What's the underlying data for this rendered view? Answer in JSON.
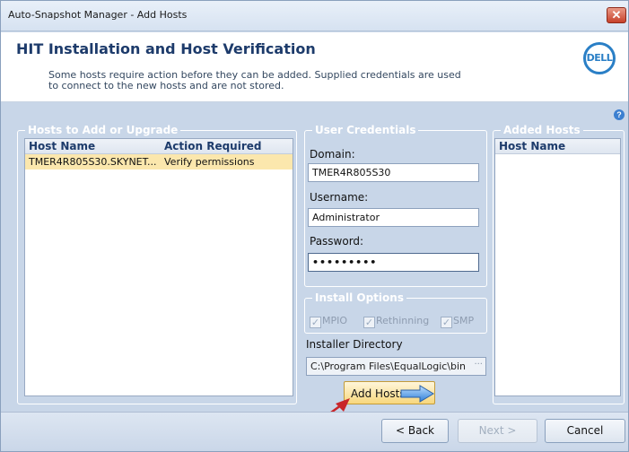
{
  "window": {
    "title": "Auto-Snapshot Manager - Add Hosts",
    "close_glyph": "✕"
  },
  "header": {
    "title": "HIT Installation and Host Verification",
    "description": "Some hosts require action before they can be added.  Supplied credentials are used to connect to the new hosts and are not stored.",
    "logo_text": "DELL"
  },
  "hosts_to_add": {
    "legend": "Hosts to Add or Upgrade",
    "columns": [
      "Host Name",
      "Action Required"
    ],
    "rows": [
      {
        "host": "TMER4R805S30.SKYNET...",
        "action": "Verify permissions"
      }
    ]
  },
  "credentials": {
    "legend": "User Credentials",
    "domain_label": "Domain:",
    "domain_value": "TMER4R805S30",
    "username_label": "Username:",
    "username_value": "Administrator",
    "password_label": "Password:",
    "password_value": "•••••••••"
  },
  "install_options": {
    "legend": "Install Options",
    "options": [
      "MPIO",
      "Rethinning",
      "SMP"
    ],
    "installer_dir_label": "Installer Directory",
    "installer_dir_value": "C:\\Program Files\\EqualLogic\\bin",
    "browse": "···"
  },
  "added_hosts": {
    "legend": "Added Hosts",
    "column": "Host Name"
  },
  "add_hosts_button": "Add Hosts",
  "footer": {
    "back": "< Back",
    "next": "Next >",
    "cancel": "Cancel"
  },
  "colors": {
    "accent": "#1d3b6b",
    "selected_row": "#fbe7ad",
    "arrow": "#c8262a"
  }
}
